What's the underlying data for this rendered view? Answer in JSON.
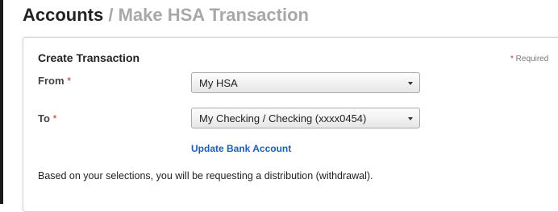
{
  "header": {
    "title": "Accounts",
    "separator": " / ",
    "subtitle": "Make HSA Transaction"
  },
  "form": {
    "section_title": "Create Transaction",
    "required_marker": "*",
    "required_text": " Required",
    "from": {
      "label": "From",
      "value": "My HSA"
    },
    "to": {
      "label": "To",
      "value": "My Checking / Checking (xxxx0454)"
    },
    "update_link": "Update Bank Account",
    "info_text": "Based on your selections, you will be requesting a distribution (withdrawal)."
  },
  "colors": {
    "required_star": "#c0392b",
    "link": "#1f5fb0",
    "subtitle_gray": "#a8a8a8"
  },
  "icons": {
    "dropdown": "chevron-down-icon"
  }
}
